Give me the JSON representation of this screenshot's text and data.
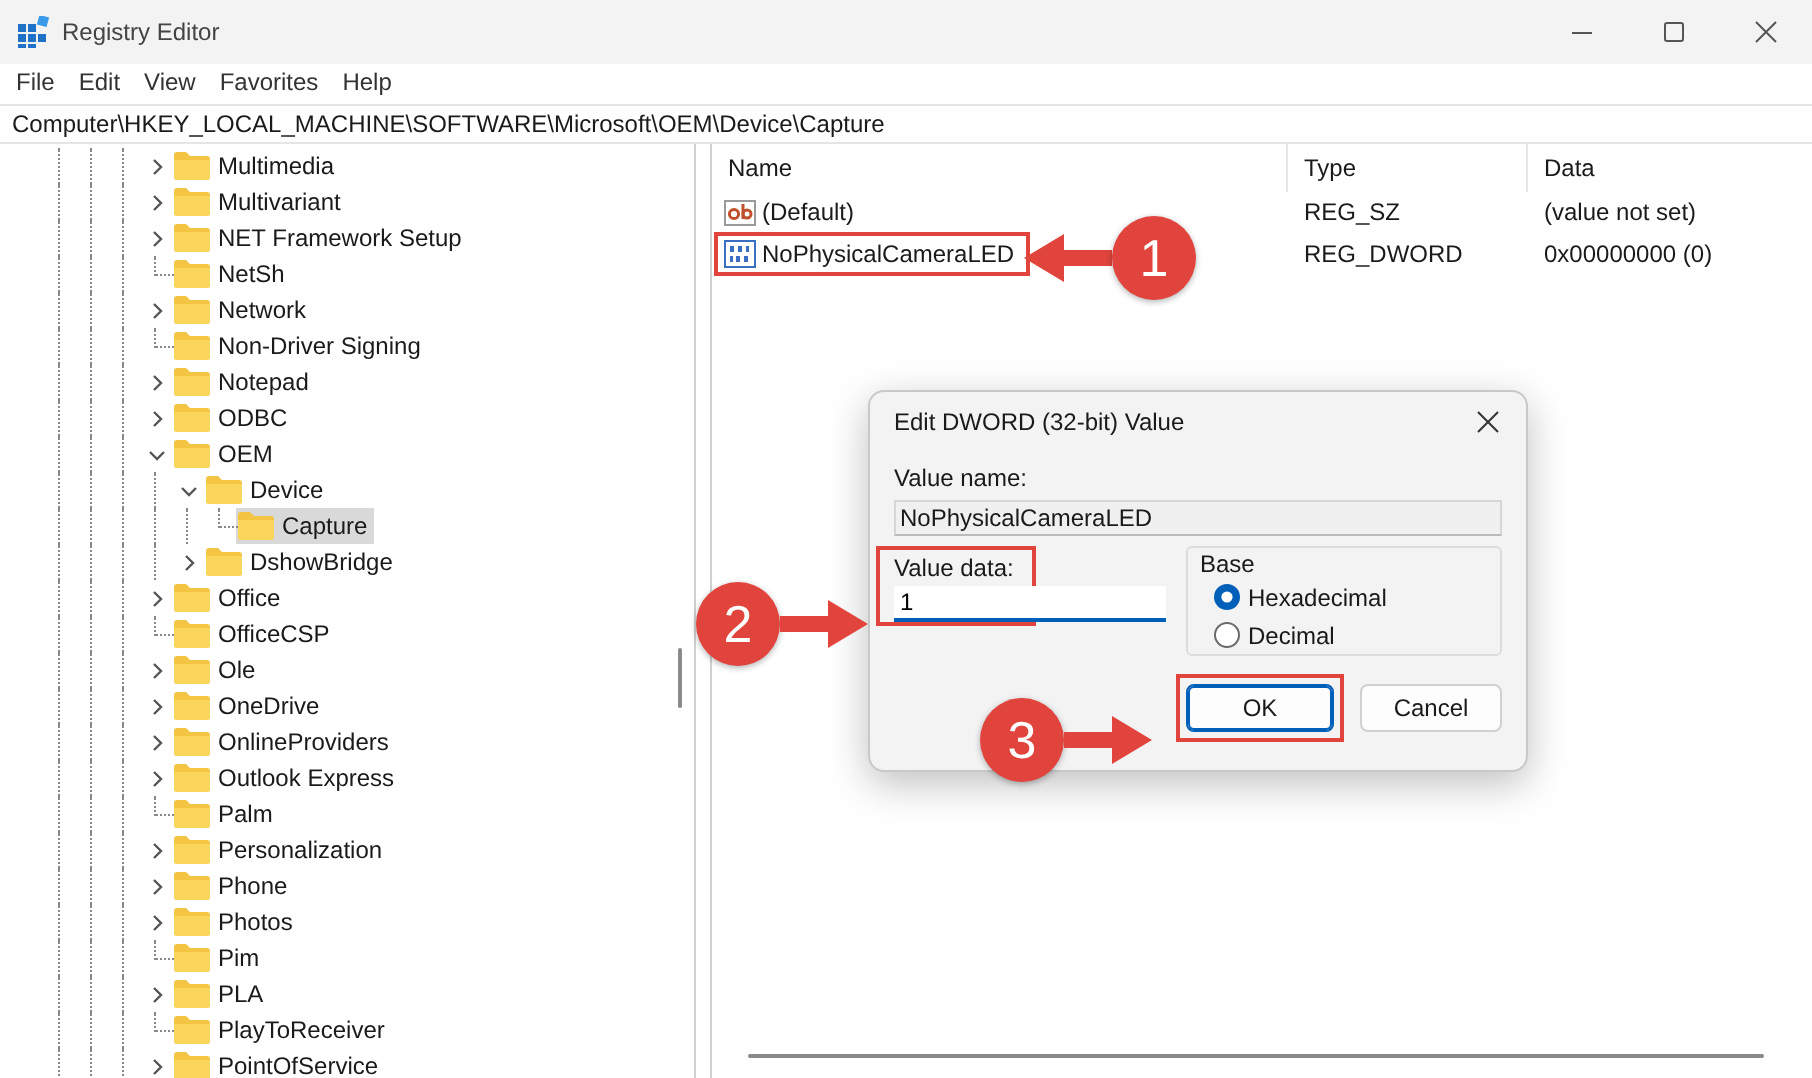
{
  "window": {
    "title": "Registry Editor"
  },
  "menu": [
    "File",
    "Edit",
    "View",
    "Favorites",
    "Help"
  ],
  "address": "Computer\\HKEY_LOCAL_MACHINE\\SOFTWARE\\Microsoft\\OEM\\Device\\Capture",
  "tree": [
    {
      "label": "Multimedia",
      "has_children": true,
      "expanded": false,
      "selected": false
    },
    {
      "label": "Multivariant",
      "has_children": true,
      "expanded": false,
      "selected": false
    },
    {
      "label": "NET Framework Setup",
      "has_children": true,
      "expanded": false,
      "selected": false
    },
    {
      "label": "NetSh",
      "has_children": false,
      "expanded": false,
      "selected": false
    },
    {
      "label": "Network",
      "has_children": true,
      "expanded": false,
      "selected": false
    },
    {
      "label": "Non-Driver Signing",
      "has_children": false,
      "expanded": false,
      "selected": false
    },
    {
      "label": "Notepad",
      "has_children": true,
      "expanded": false,
      "selected": false
    },
    {
      "label": "ODBC",
      "has_children": true,
      "expanded": false,
      "selected": false
    },
    {
      "label": "OEM",
      "has_children": true,
      "expanded": true,
      "selected": false,
      "children": [
        {
          "label": "Device",
          "has_children": true,
          "expanded": true,
          "selected": false,
          "children": [
            {
              "label": "Capture",
              "has_children": false,
              "expanded": false,
              "selected": true
            }
          ]
        },
        {
          "label": "DshowBridge",
          "has_children": true,
          "expanded": false,
          "selected": false
        }
      ]
    },
    {
      "label": "Office",
      "has_children": true,
      "expanded": false,
      "selected": false
    },
    {
      "label": "OfficeCSP",
      "has_children": false,
      "expanded": false,
      "selected": false
    },
    {
      "label": "Ole",
      "has_children": true,
      "expanded": false,
      "selected": false
    },
    {
      "label": "OneDrive",
      "has_children": true,
      "expanded": false,
      "selected": false
    },
    {
      "label": "OnlineProviders",
      "has_children": true,
      "expanded": false,
      "selected": false
    },
    {
      "label": "Outlook Express",
      "has_children": true,
      "expanded": false,
      "selected": false
    },
    {
      "label": "Palm",
      "has_children": false,
      "expanded": false,
      "selected": false
    },
    {
      "label": "Personalization",
      "has_children": true,
      "expanded": false,
      "selected": false
    },
    {
      "label": "Phone",
      "has_children": true,
      "expanded": false,
      "selected": false
    },
    {
      "label": "Photos",
      "has_children": true,
      "expanded": false,
      "selected": false
    },
    {
      "label": "Pim",
      "has_children": false,
      "expanded": false,
      "selected": false
    },
    {
      "label": "PLA",
      "has_children": true,
      "expanded": false,
      "selected": false
    },
    {
      "label": "PlayToReceiver",
      "has_children": false,
      "expanded": false,
      "selected": false
    },
    {
      "label": "PointOfService",
      "has_children": true,
      "expanded": false,
      "selected": false
    }
  ],
  "values": {
    "columns": [
      "Name",
      "Type",
      "Data"
    ],
    "rows": [
      {
        "name": "(Default)",
        "kind": "string",
        "type": "REG_SZ",
        "data": "(value not set)",
        "highlighted": false
      },
      {
        "name": "NoPhysicalCameraLED",
        "kind": "binary",
        "type": "REG_DWORD",
        "data": "0x00000000 (0)",
        "highlighted": true
      }
    ]
  },
  "dialog": {
    "title": "Edit DWORD (32-bit) Value",
    "value_name_label": "Value name:",
    "value_name": "NoPhysicalCameraLED",
    "value_data_label": "Value data:",
    "value_data": "1",
    "value_data_highlighted": true,
    "base_label": "Base",
    "bases": [
      {
        "label": "Hexadecimal",
        "selected": true
      },
      {
        "label": "Decimal",
        "selected": false
      }
    ],
    "buttons": [
      {
        "label": "OK",
        "default": true,
        "highlighted": true
      },
      {
        "label": "Cancel",
        "default": false,
        "highlighted": false
      }
    ]
  },
  "callouts": [
    {
      "label": "1"
    },
    {
      "label": "2"
    },
    {
      "label": "3"
    }
  ]
}
